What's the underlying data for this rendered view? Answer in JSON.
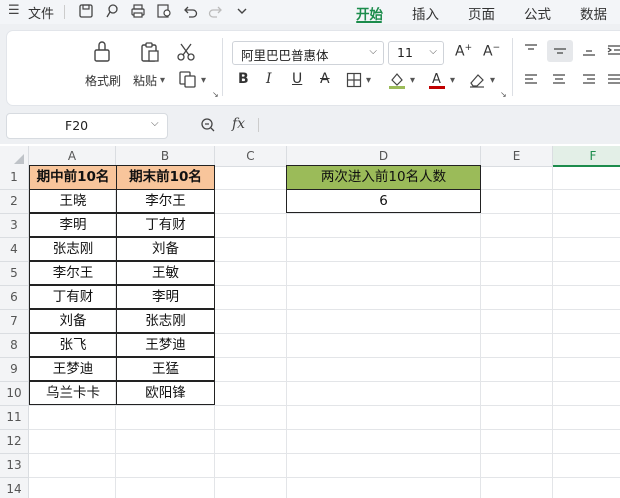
{
  "menu": {
    "file_label": "文件",
    "tabs": [
      {
        "label": "开始",
        "active": true
      },
      {
        "label": "插入",
        "active": false
      },
      {
        "label": "页面",
        "active": false
      },
      {
        "label": "公式",
        "active": false
      },
      {
        "label": "数据",
        "active": false
      }
    ]
  },
  "ribbon": {
    "format_painter": "格式刷",
    "paste": "粘贴",
    "font_name": "阿里巴巴普惠体",
    "font_size": "11"
  },
  "formula_bar": {
    "cell_ref": "F20",
    "fx": "fx",
    "formula": ""
  },
  "sheet": {
    "columns": [
      "A",
      "B",
      "C",
      "D",
      "E",
      "F"
    ],
    "selected_column": "F",
    "rows": [
      "1",
      "2",
      "3",
      "4",
      "5",
      "6",
      "7",
      "8",
      "9",
      "10",
      "11",
      "12",
      "13",
      "14"
    ],
    "table1": {
      "header_a": "期中前10名",
      "header_b": "期末前10名",
      "col_a": [
        "王晓",
        "李明",
        "张志刚",
        "李尔王",
        "丁有财",
        "刘备",
        "张飞",
        "王梦迪",
        "乌兰卡卡"
      ],
      "col_b": [
        "李尔王",
        "丁有财",
        "刘备",
        "王敏",
        "李明",
        "张志刚",
        "王梦迪",
        "王猛",
        "欧阳锋"
      ]
    },
    "summary": {
      "header": "两次进入前10名人数",
      "value": "6"
    }
  },
  "colors": {
    "accent": "#1c8c4c",
    "header_orange": "#f8c59b",
    "header_green": "#9bbb59"
  }
}
